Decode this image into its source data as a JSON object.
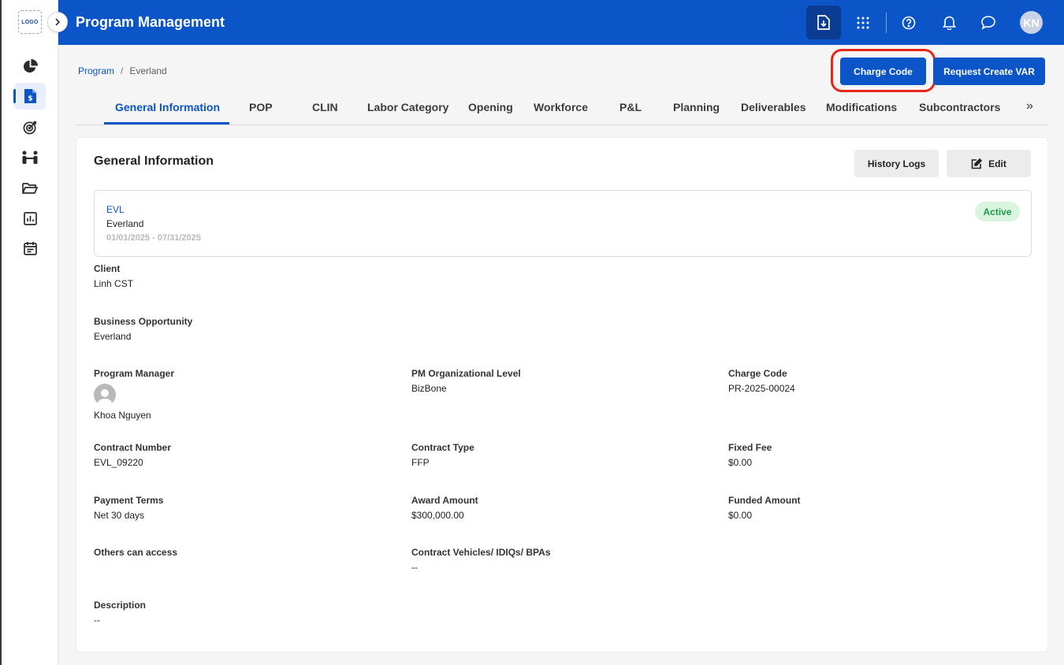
{
  "sidebar": {
    "logo_text": "LOGO",
    "items": [
      {
        "icon": "pie-chart-icon"
      },
      {
        "icon": "program-document-icon",
        "active": true
      },
      {
        "icon": "target-icon"
      },
      {
        "icon": "team-icon"
      },
      {
        "icon": "folder-icon"
      },
      {
        "icon": "report-chart-icon"
      },
      {
        "icon": "calendar-icon"
      }
    ]
  },
  "header": {
    "title": "Program Management",
    "avatar_initials": "KN"
  },
  "breadcrumb": {
    "parent": "Program",
    "separator": "/",
    "current": "Everland"
  },
  "actions": {
    "charge_code_label": "Charge Code",
    "request_var_label": "Request Create VAR"
  },
  "tabs": [
    {
      "label": "General Information",
      "active": true
    },
    {
      "label": "POP"
    },
    {
      "label": "CLIN"
    },
    {
      "label": "Labor Category"
    },
    {
      "label": "Opening"
    },
    {
      "label": "Workforce"
    },
    {
      "label": "P&L"
    },
    {
      "label": "Planning"
    },
    {
      "label": "Deliverables"
    },
    {
      "label": "Modifications"
    },
    {
      "label": "Subcontractors"
    }
  ],
  "tabs_more": "»",
  "card": {
    "title": "General Information",
    "history_label": "History Logs",
    "edit_label": "Edit"
  },
  "summary": {
    "code": "EVL",
    "name": "Everland",
    "dates": "01/01/2025 - 07/31/2025",
    "status": "Active"
  },
  "fields": {
    "client": {
      "label": "Client",
      "value": "Linh CST"
    },
    "business_opportunity": {
      "label": "Business Opportunity",
      "value": "Everland"
    },
    "program_manager": {
      "label": "Program Manager",
      "value": "Khoa Nguyen"
    },
    "pm_org_level": {
      "label": "PM Organizational Level",
      "value": "BizBone"
    },
    "charge_code": {
      "label": "Charge Code",
      "value": "PR-2025-00024"
    },
    "contract_number": {
      "label": "Contract Number",
      "value": "EVL_09220"
    },
    "contract_type": {
      "label": "Contract Type",
      "value": "FFP"
    },
    "fixed_fee": {
      "label": "Fixed Fee",
      "value": "$0.00"
    },
    "payment_terms": {
      "label": "Payment Terms",
      "value": "Net 30 days"
    },
    "award_amount": {
      "label": "Award Amount",
      "value": "$300,000.00"
    },
    "funded_amount": {
      "label": "Funded Amount",
      "value": "$0.00"
    },
    "others_access": {
      "label": "Others can access",
      "value": ""
    },
    "contract_vehicles": {
      "label": "Contract Vehicles/ IDIQs/ BPAs",
      "value": "--"
    },
    "description": {
      "label": "Description",
      "value": "--"
    }
  },
  "colors": {
    "primary": "#0b55c9",
    "highlight": "#e8261b",
    "status_green": "#1e9a4a"
  }
}
